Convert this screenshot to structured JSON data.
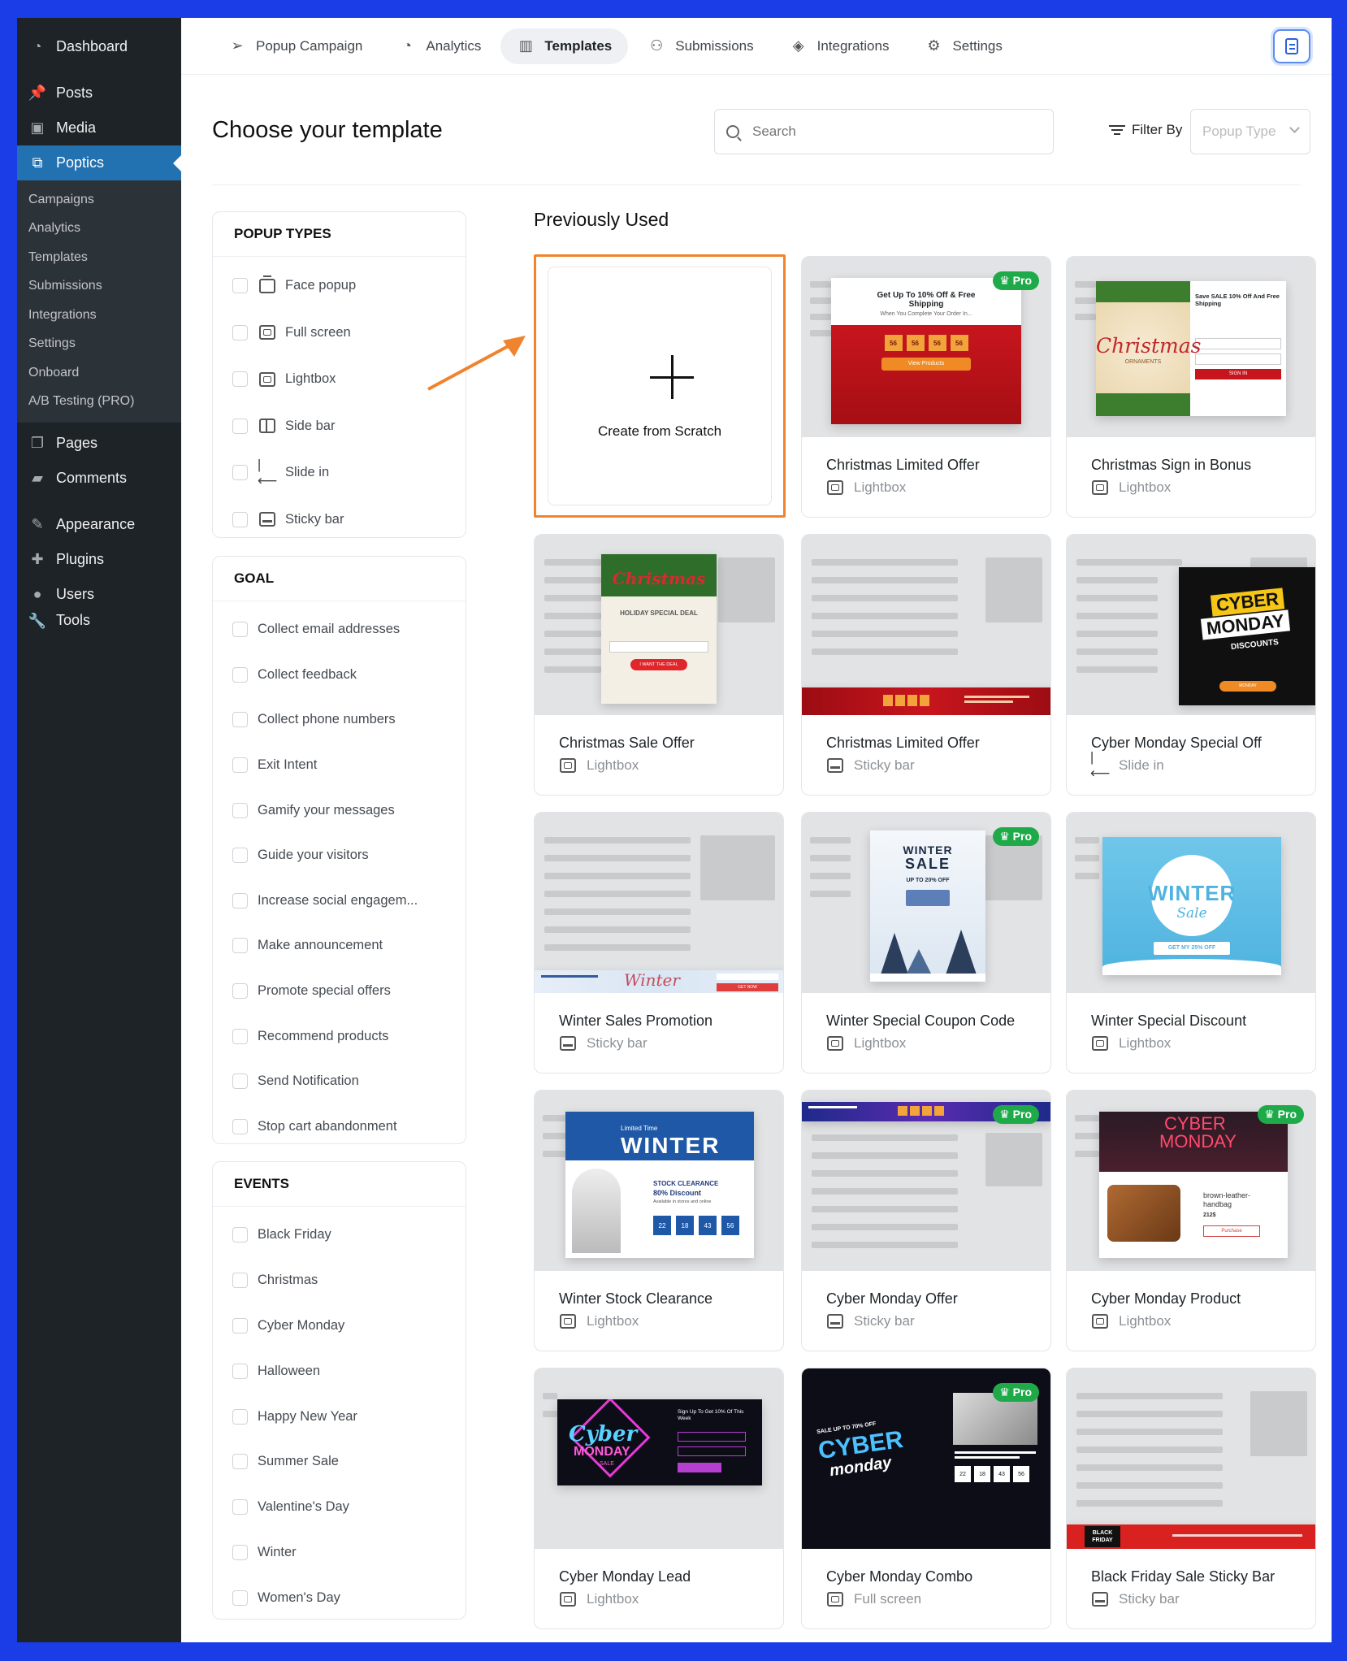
{
  "wp_menu": {
    "dashboard": "Dashboard",
    "posts": "Posts",
    "media": "Media",
    "poptics": "Poptics",
    "sub": [
      "Campaigns",
      "Analytics",
      "Templates",
      "Submissions",
      "Integrations",
      "Settings",
      "Onboard",
      "A/B Testing (PRO)"
    ],
    "pages": "Pages",
    "comments": "Comments",
    "appearance": "Appearance",
    "plugins": "Plugins",
    "users": "Users",
    "tools": "Tools"
  },
  "tabs": [
    "Popup Campaign",
    "Analytics",
    "Templates",
    "Submissions",
    "Integrations",
    "Settings"
  ],
  "page_title": "Choose your template",
  "search": {
    "placeholder": "Search"
  },
  "filter": {
    "label": "Filter By",
    "select_placeholder": "Popup Type"
  },
  "panels": {
    "popup_types": {
      "title": "POPUP TYPES",
      "items": [
        "Face popup",
        "Full screen",
        "Lightbox",
        "Side bar",
        "Slide in",
        "Sticky bar"
      ]
    },
    "goal": {
      "title": "GOAL",
      "items": [
        "Collect email addresses",
        "Collect feedback",
        "Collect phone numbers",
        "Exit Intent",
        "Gamify your messages",
        "Guide your visitors",
        "Increase social engagem...",
        "Make announcement",
        "Promote special offers",
        "Recommend products",
        "Send Notification",
        "Stop cart abandonment"
      ]
    },
    "events": {
      "title": "EVENTS",
      "items": [
        "Black Friday",
        "Christmas",
        "Cyber Monday",
        "Halloween",
        "Happy New Year",
        "Summer Sale",
        "Valentine's Day",
        "Winter",
        "Women's Day"
      ]
    }
  },
  "section_title": "Previously Used",
  "scratch_label": "Create from Scratch",
  "pro_label": "Pro",
  "templates": [
    {
      "name": "Christmas Limited Offer",
      "type": "Lightbox"
    },
    {
      "name": "Christmas Sign in Bonus",
      "type": "Lightbox"
    },
    {
      "name": "Christmas Sale Offer",
      "type": "Lightbox"
    },
    {
      "name": "Christmas Limited Offer",
      "type": "Sticky bar"
    },
    {
      "name": "Cyber Monday Special Off",
      "type": "Slide in"
    },
    {
      "name": "Winter Sales Promotion",
      "type": "Sticky bar"
    },
    {
      "name": "Winter Special Coupon Code",
      "type": "Lightbox"
    },
    {
      "name": "Winter Special Discount",
      "type": "Lightbox"
    },
    {
      "name": "Winter Stock Clearance",
      "type": "Lightbox"
    },
    {
      "name": "Cyber Monday Offer",
      "type": "Sticky bar"
    },
    {
      "name": "Cyber Monday Product",
      "type": "Lightbox"
    },
    {
      "name": "Cyber Monday Lead",
      "type": "Lightbox"
    },
    {
      "name": "Cyber Monday Combo",
      "type": "Full screen"
    },
    {
      "name": "Black Friday Sale Sticky Bar",
      "type": "Sticky bar"
    }
  ],
  "thumb_text": {
    "t0_head": "Get Up To 10% Off & Free Shipping",
    "t0_sub": "When You Complete Your Order In...",
    "t0_btn": "View Products",
    "t0_count": [
      "56",
      "56",
      "56",
      "56"
    ],
    "t1_word": "Christmas",
    "t1_sub": "ORNAMENTS",
    "t1_head": "Save SALE 10% Off And Free Shipping",
    "t1_btn": "SIGN IN",
    "t2_word": "Christmas",
    "t2_head": "HOLIDAY SPECIAL DEAL",
    "t2_btn": "I WANT THE DEAL",
    "t4_top": "CYBER",
    "t4_mid": "MONDAY",
    "t4_sub": "DISCOUNTS",
    "t4_btn": "MONDAY",
    "t5_word": "Winter",
    "t5_btn": "GET NOW",
    "t6_top": "WINTER",
    "t6_big": "SALE",
    "t6_sub": "UP TO 20% OFF",
    "t7_top": "WINTER",
    "t7_sub": "Sale",
    "t7_btn": "GET MY 25% OFF",
    "t8_tag": "Limited Time",
    "t8_big": "WINTER",
    "t8_h1": "STOCK CLEARANCE",
    "t8_h2": "80% Discount",
    "t8_small": "Available in stores and online",
    "t8_count": [
      "22",
      "18",
      "43",
      "56"
    ],
    "t10_top": "CYBER",
    "t10_mid": "MONDAY",
    "t10_prod": "brown-leather-handbag",
    "t10_price": "212$",
    "t10_btn": "Purchase",
    "t11_word": "Cyber",
    "t11_mid": "MONDAY",
    "t11_sale": "SALE",
    "t11_head": "Sign Up To Get 10% Of This Week",
    "t12_sale": "SALE UP TO 70% OFF",
    "t12_big": "CYBER",
    "t12_mid": "monday",
    "t12_count": [
      "22",
      "18",
      "43",
      "56"
    ],
    "t13_word": "BLACK FRIDAY"
  }
}
